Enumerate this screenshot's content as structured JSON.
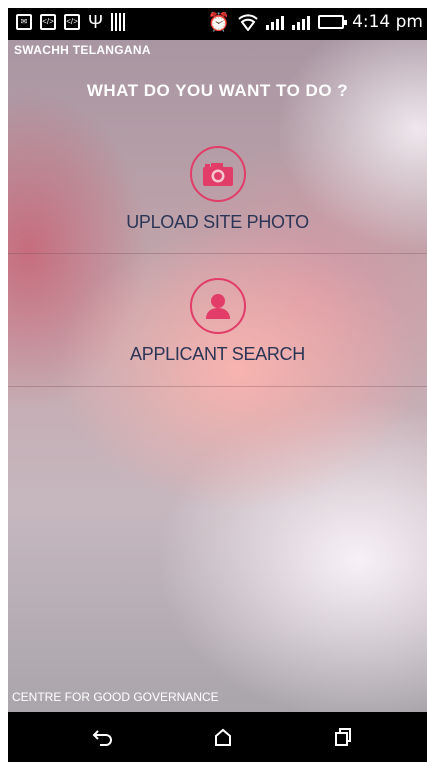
{
  "status_bar": {
    "time": "4:14 pm",
    "left_icons": [
      "notification-icon",
      "code-icon",
      "code-icon",
      "usb-icon",
      "barcode-icon"
    ],
    "right_icons": [
      "alarm-icon",
      "wifi-icon",
      "signal-icon",
      "signal-icon",
      "battery-icon"
    ]
  },
  "app": {
    "title": "SWACHH TELANGANA",
    "question": "WHAT DO YOU WANT TO DO ?",
    "actions": [
      {
        "label": "UPLOAD SITE PHOTO",
        "icon": "camera-icon"
      },
      {
        "label": "APPLICANT SEARCH",
        "icon": "person-icon"
      }
    ],
    "footer": "CENTRE FOR GOOD GOVERNANCE"
  },
  "nav_bar": {
    "buttons": [
      "back-icon",
      "home-icon",
      "recent-apps-icon"
    ]
  },
  "colors": {
    "accent": "#e23c68",
    "label_text": "#2b3556"
  }
}
